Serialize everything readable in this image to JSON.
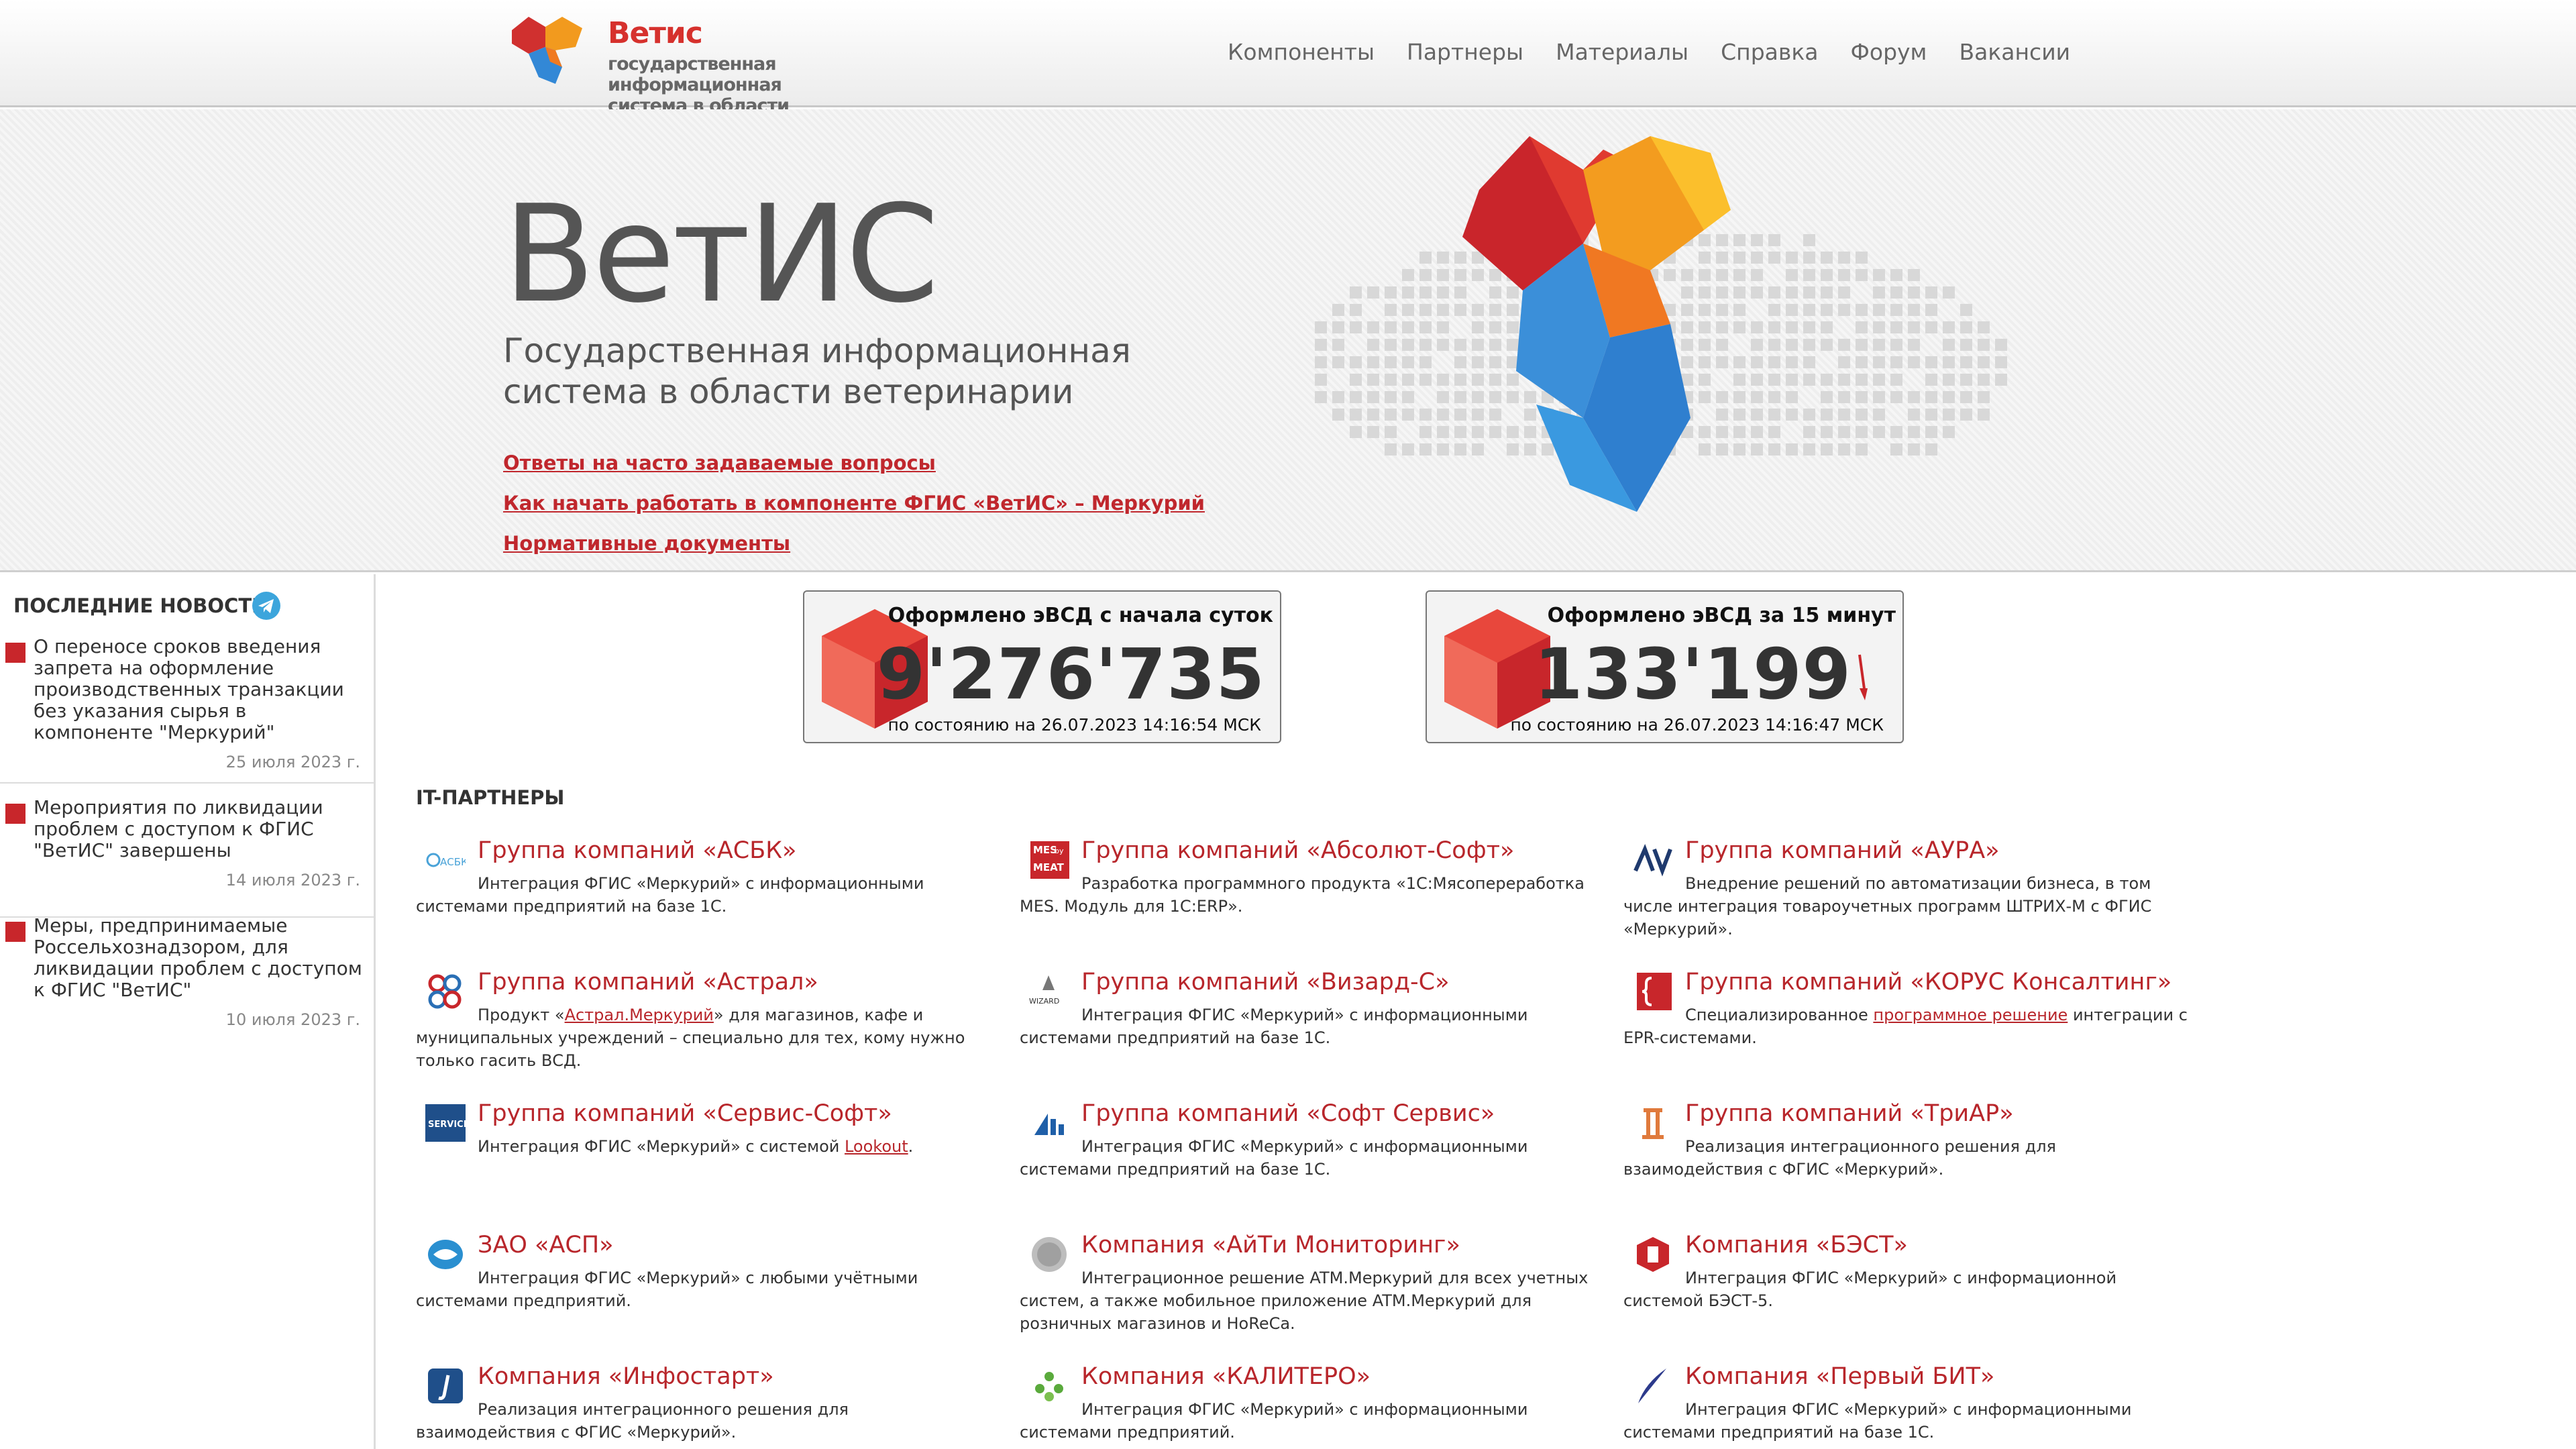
{
  "header": {
    "logo_title": "Ветис",
    "logo_sub_1": "государственная информационная",
    "logo_sub_2": "система в области ветеринарии",
    "nav": [
      "Компоненты",
      "Партнеры",
      "Материалы",
      "Справка",
      "Форум",
      "Вакансии"
    ]
  },
  "hero": {
    "title": "ВетИС",
    "subtitle_1": "Государственная информационная",
    "subtitle_2": "система в области ветеринарии",
    "links": [
      "Ответы на часто задаваемые вопросы",
      "Как начать работать в компоненте ФГИС «ВетИС» – Меркурий",
      "Нормативные документы"
    ]
  },
  "sidebar": {
    "title": "ПОСЛЕДНИЕ НОВОСТИ",
    "news": [
      {
        "text": "О переносе сроков введения запрета на оформление производственных транзакции без указания сырья в компоненте \"Меркурий\"",
        "date": "25 июля 2023 г."
      },
      {
        "text": "Мероприятия по ликвидации проблем с доступом к ФГИС \"ВетИС\" завершены",
        "date": "14 июля 2023 г."
      },
      {
        "text": "Меры, предпринимаемые Россельхознадзором, для ликвидации проблем с доступом к ФГИС \"ВетИС\"",
        "date": "10 июля 2023 г."
      }
    ]
  },
  "counters": [
    {
      "title": "Оформлено эВСД с начала суток",
      "value": "9'276'735",
      "status": "по состоянию на 26.07.2023 14:16:54 МСК"
    },
    {
      "title": "Оформлено эВСД за 15 минут",
      "value": "133'199",
      "status": "по состоянию на 26.07.2023 14:16:47 МСК"
    }
  ],
  "partners_title": "IT-ПАРТНЕРЫ",
  "partners": [
    {
      "name": "Группа компаний «АСБК»",
      "desc": "Интеграция ФГИС «Меркурий» с информационными системами предприятий на базе 1С.",
      "logo": "asbk-logo"
    },
    {
      "name": "Группа компаний «Абсолют-Софт»",
      "desc": "Разработка программного продукта «1С:Мясопереработка MES. Модуль для 1С:ERP».",
      "logo": "mes-meat-logo"
    },
    {
      "name": "Группа компаний «АУРА»",
      "desc": "Внедрение решений по автоматизации бизнеса, в том числе интеграция товароучетных программ ШТРИХ-М с ФГИС «Меркурий».",
      "logo": "aura-logo"
    },
    {
      "name": "Группа компаний «Астрал»",
      "desc_pre": "Продукт «",
      "desc_link": "Астрал.Меркурий",
      "desc_post": "» для магазинов, кафе и муниципальных учреждений – специально для тех, кому нужно только гасить ВСД.",
      "logo": "astral-logo"
    },
    {
      "name": "Группа компаний «Визард-С»",
      "desc": "Интеграция ФГИС «Меркурий» с информационными системами предприятий на базе 1С.",
      "logo": "wizard-logo"
    },
    {
      "name": "Группа компаний «КОРУС Консалтинг»",
      "desc_pre": "Специализированное ",
      "desc_link": "программное решение",
      "desc_post": " интеграции с EPR-системами.",
      "logo": "korus-logo"
    },
    {
      "name": "Группа компаний «Сервис-Софт»",
      "desc_pre": "Интеграция ФГИС «Меркурий» с системой ",
      "desc_link": "Lookout",
      "desc_post": ".",
      "logo": "servis-soft-logo"
    },
    {
      "name": "Группа компаний «Софт Сервис»",
      "desc": "Интеграция ФГИС «Меркурий» с информационными системами предприятий на базе 1С.",
      "logo": "soft-servis-logo"
    },
    {
      "name": "Группа компаний «ТриАР»",
      "desc": "Реализация интеграционного решения для взаимодействия с ФГИС «Меркурий».",
      "logo": "triar-logo"
    },
    {
      "name": "ЗАО «АСП»",
      "desc": "Интеграция ФГИС «Меркурий» с любыми учётными системами предприятий.",
      "logo": "asp-logo"
    },
    {
      "name": "Компания «АйТи Мониторинг»",
      "desc": "Интеграционное решение ATM.Меркурий для всех учетных систем, а также мобильное приложение ATM.Меркурий для розничных магазинов и HoReCa.",
      "logo": "it-monitoring-logo"
    },
    {
      "name": "Компания «БЭСТ»",
      "desc": "Интеграция ФГИС «Меркурий» с информационной системой БЭСТ-5.",
      "logo": "best-logo"
    },
    {
      "name": "Компания «Инфостарт»",
      "desc": "Реализация интеграционного решения для взаимодействия с ФГИС «Меркурий».",
      "logo": "infostart-logo"
    },
    {
      "name": "Компания «КАЛИТЕРО»",
      "desc": "Интеграция ФГИС «Меркурий» с информационными системами предприятий.",
      "logo": "kalitero-logo"
    },
    {
      "name": "Компания «Первый БИТ»",
      "desc": "Интеграция ФГИС «Меркурий» с информационными системами предприятий на базе 1С.",
      "logo": "pervyi-bit-logo"
    }
  ],
  "partner_logo_texts": {
    "asbk": "АСБК",
    "mes_1": "MES",
    "mes_2": "by",
    "mes_3": "MEAT",
    "wizard": "WIZARD",
    "servis_soft": "SERVICE SOFT"
  }
}
